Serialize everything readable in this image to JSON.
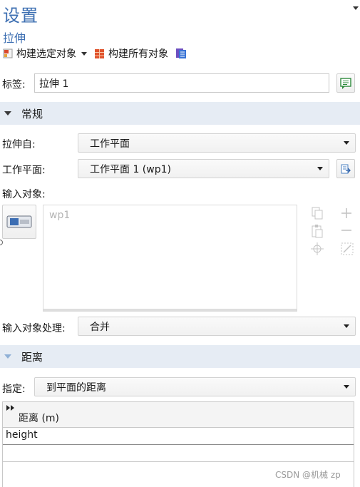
{
  "panel": {
    "title": "设置",
    "subtitle": "拉伸"
  },
  "toolbar": {
    "build_selected": "构建选定对象",
    "build_all": "构建所有对象"
  },
  "label_row": {
    "label": "标签:",
    "value": "拉伸 1"
  },
  "general": {
    "section_title": "常规",
    "extrude_from_label": "拉伸自:",
    "extrude_from_value": "工作平面",
    "workplane_label": "工作平面:",
    "workplane_value": "工作平面 1 (wp1)",
    "input_objects_label": "输入对象:",
    "input_objects_items": [
      "wp1"
    ],
    "input_handling_label": "输入对象处理:",
    "input_handling_value": "合并"
  },
  "distance": {
    "section_title": "距离",
    "specify_label": "指定:",
    "specify_value": "到平面的距离",
    "table_header": "距离 (m)",
    "rows": [
      "height",
      ""
    ]
  },
  "watermark": "CSDN @机械 zp",
  "colors": {
    "accent": "#3d6fb2",
    "section_bg": "#e6ecf4"
  }
}
